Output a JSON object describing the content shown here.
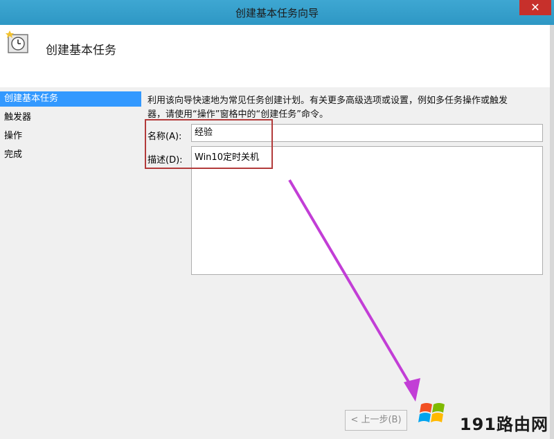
{
  "window": {
    "title": "创建基本任务向导",
    "close_label": "✕"
  },
  "header": {
    "heading": "创建基本任务"
  },
  "nav": {
    "items": [
      {
        "label": "创建基本任务",
        "active": true
      },
      {
        "label": "触发器",
        "active": false
      },
      {
        "label": "操作",
        "active": false
      },
      {
        "label": "完成",
        "active": false
      }
    ]
  },
  "main": {
    "description_line1": "利用该向导快速地为常见任务创建计划。有关更多高级选项或设置，例如多任务操作或触发",
    "description_line2": "器，请使用“操作”窗格中的“创建任务”命令。",
    "name_label": "名称(A):",
    "name_value": "经验",
    "desc_label": "描述(D):",
    "desc_value": "Win10定时关机"
  },
  "footer": {
    "back_button": "< 上一步(B)"
  },
  "watermark": {
    "text": "191路由网"
  },
  "colors": {
    "titlebar": "#2e97c4",
    "nav_active": "#3399ff",
    "highlight_box": "#b23a3a",
    "arrow": "#c23ed6"
  }
}
